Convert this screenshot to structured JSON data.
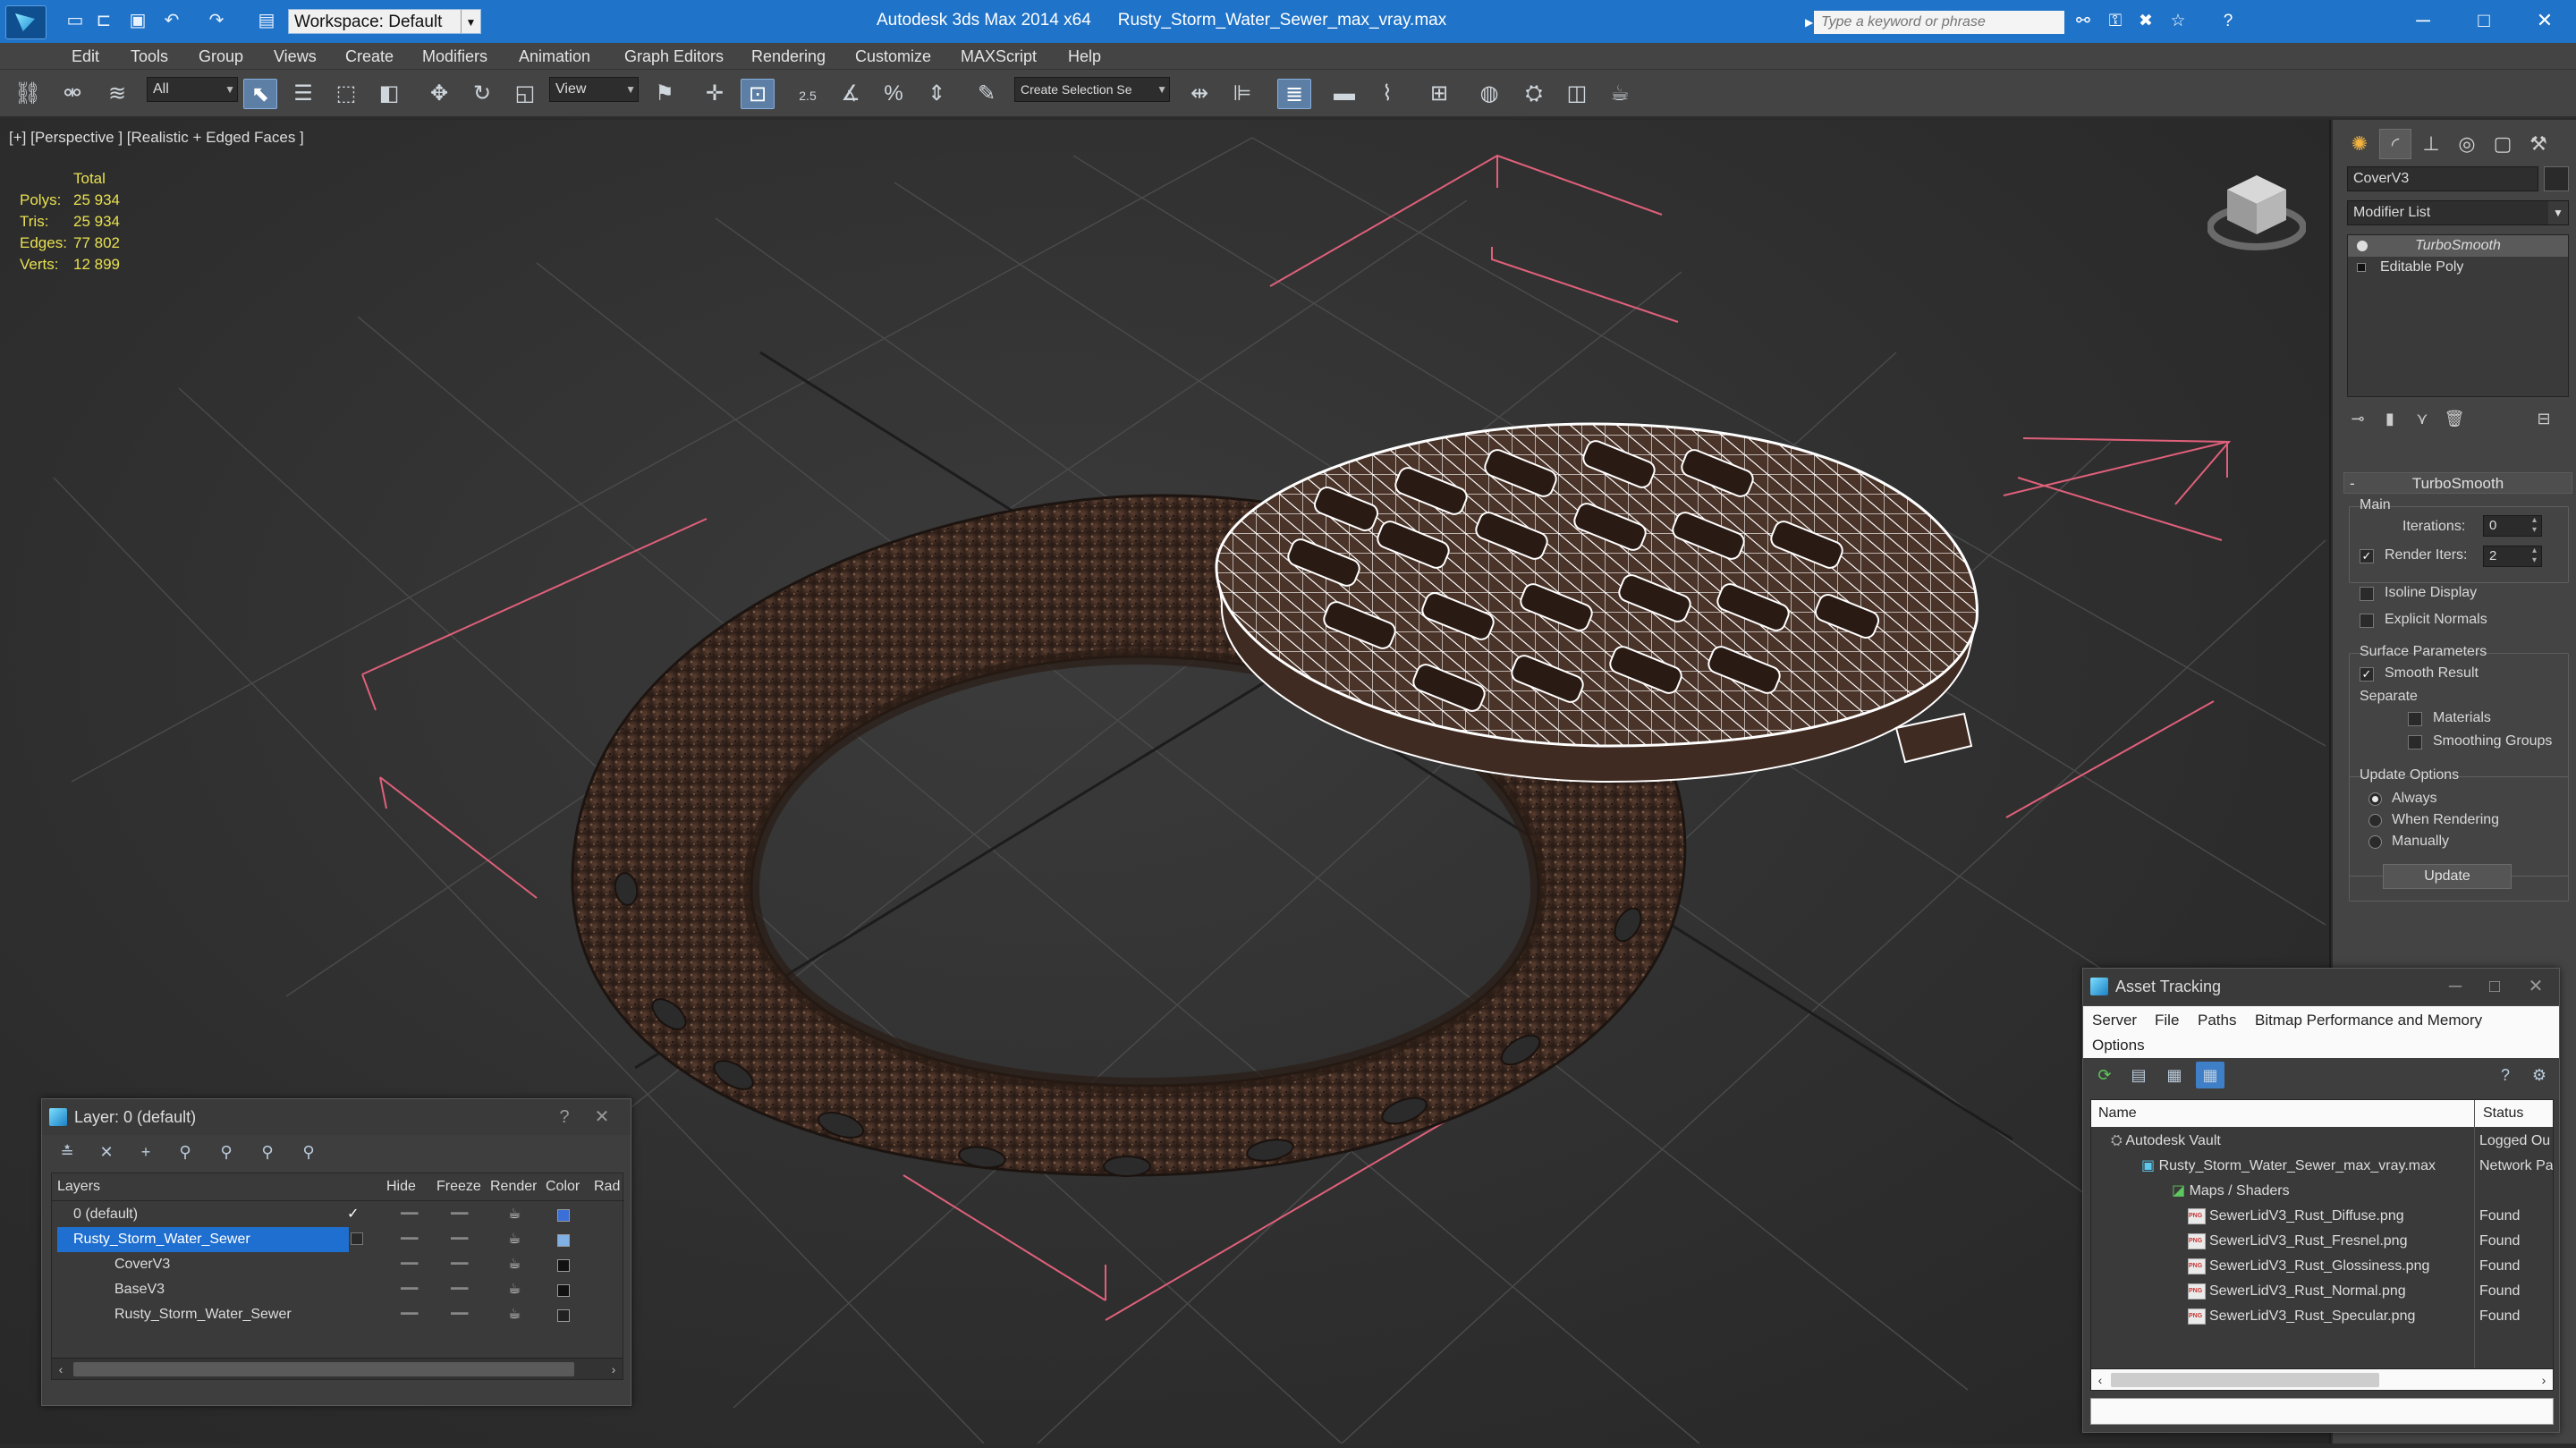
{
  "titlebar": {
    "workspace": "Workspace: Default",
    "app": "Autodesk 3ds Max  2014 x64",
    "file": "Rusty_Storm_Water_Sewer_max_vray.max",
    "search_placeholder": "Type a keyword or phrase"
  },
  "menu": [
    "Edit",
    "Tools",
    "Group",
    "Views",
    "Create",
    "Modifiers",
    "Animation",
    "Graph Editors",
    "Rendering",
    "Customize",
    "MAXScript",
    "Help"
  ],
  "toolbar": {
    "filter_select": "All",
    "coord_select": "View",
    "snap_label": "2.5",
    "named_selection": "Create Selection Se"
  },
  "viewport": {
    "label": "[+] [Perspective ] [Realistic + Edged Faces ]",
    "stats": {
      "header": "Total",
      "rows": [
        {
          "label": "Polys:",
          "value": "25 934"
        },
        {
          "label": "Tris:",
          "value": "25 934"
        },
        {
          "label": "Edges:",
          "value": "77 802"
        },
        {
          "label": "Verts:",
          "value": "12 899"
        }
      ]
    }
  },
  "command_panel": {
    "object_name": "CoverV3",
    "modifier_list": "Modifier List",
    "stack": [
      "TurboSmooth",
      "Editable Poly"
    ],
    "rollout_title": "TurboSmooth",
    "main_group": "Main",
    "iterations_label": "Iterations:",
    "iterations_value": "0",
    "render_iters_label": "Render Iters:",
    "render_iters_value": "2",
    "render_iters_checked": true,
    "isoline_label": "Isoline Display",
    "explicit_normals_label": "Explicit Normals",
    "surface_group": "Surface Parameters",
    "smooth_result_label": "Smooth Result",
    "separate_label": "Separate",
    "materials_label": "Materials",
    "smoothing_groups_label": "Smoothing Groups",
    "update_group": "Update Options",
    "always_label": "Always",
    "when_rendering_label": "When Rendering",
    "manually_label": "Manually",
    "update_button": "Update"
  },
  "layer_dialog": {
    "title": "Layer: 0 (default)",
    "help": "?",
    "columns": [
      "Layers",
      "Hide",
      "Freeze",
      "Render",
      "Color",
      "Rad"
    ],
    "rows": [
      {
        "name": "0 (default)",
        "color": "#3a6fd8",
        "check": "✓"
      },
      {
        "name": "Rusty_Storm_Water_Sewer",
        "color": "#7fb0e6",
        "check": ""
      },
      {
        "name": "CoverV3",
        "color": "#111111",
        "check": ""
      },
      {
        "name": "BaseV3",
        "color": "#111111",
        "check": ""
      },
      {
        "name": "Rusty_Storm_Water_Sewer",
        "color": "#222222",
        "check": ""
      }
    ]
  },
  "asset_dialog": {
    "title": "Asset Tracking",
    "menu": [
      "Server",
      "File",
      "Paths",
      "Bitmap Performance and Memory",
      "Options"
    ],
    "columns": [
      "Name",
      "Status"
    ],
    "rows": [
      {
        "name": "Autodesk Vault",
        "status": "Logged Ou"
      },
      {
        "name": "Rusty_Storm_Water_Sewer_max_vray.max",
        "status": "Network Pa"
      },
      {
        "name": "Maps / Shaders",
        "status": ""
      },
      {
        "name": "SewerLidV3_Rust_Diffuse.png",
        "status": "Found"
      },
      {
        "name": "SewerLidV3_Rust_Fresnel.png",
        "status": "Found"
      },
      {
        "name": "SewerLidV3_Rust_Glossiness.png",
        "status": "Found"
      },
      {
        "name": "SewerLidV3_Rust_Normal.png",
        "status": "Found"
      },
      {
        "name": "SewerLidV3_Rust_Specular.png",
        "status": "Found"
      }
    ]
  },
  "colors": {
    "titlebar": "#1f73c8",
    "stats_text": "#e8e050",
    "bbox_lines": "#e0607a",
    "selection": "#1f6fd0"
  }
}
